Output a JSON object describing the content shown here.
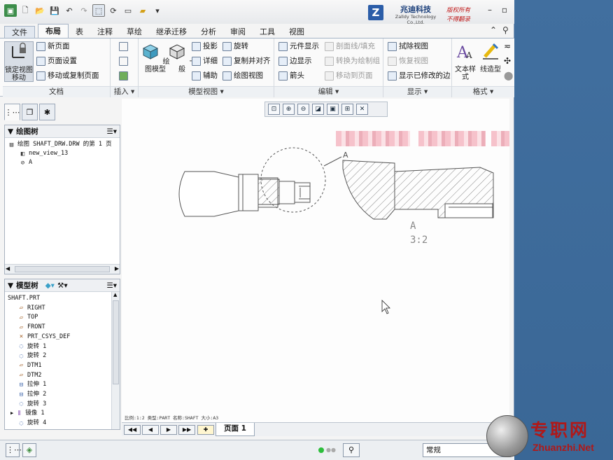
{
  "titlebar": {
    "logo_mark": "Z",
    "logo_cn": "兆迪科技",
    "logo_en": "Zalldy Technology Co.,Ltd.",
    "rights_1": "版权所有",
    "rights_2": "不得翻录"
  },
  "menu": {
    "file": "文件",
    "tabs": [
      "布局",
      "表",
      "注释",
      "草绘",
      "继承迁移",
      "分析",
      "审阅",
      "工具",
      "视图"
    ],
    "active_tab": "布局"
  },
  "ribbon": {
    "doc": {
      "lock_label": "锁定视图移动",
      "new_page": "新页面",
      "page_setup": "页面设置",
      "move_copy_page": "移动或复制页面",
      "group": "文档"
    },
    "insert": {
      "group": "插入"
    },
    "model_views": {
      "drawing_model": "绘图模型",
      "general": "一般",
      "projection": "投影",
      "detailed": "详细",
      "auxiliary": "辅助",
      "revolve": "旋转",
      "copy_align": "复制并对齐",
      "drawing_view": "绘图视图",
      "group": "模型视图"
    },
    "edit": {
      "element_display": "元件显示",
      "edge_display": "边显示",
      "arrow": "箭头",
      "section_line_fill": "剖面线/填充",
      "convert_to_draft": "转换为绘制组",
      "move_to_page": "移动到页面",
      "group": "编辑"
    },
    "display": {
      "erase_view": "拭除视图",
      "restore_view": "恢复视图",
      "show_modified_edges": "显示已修改的边",
      "group": "显示"
    },
    "format": {
      "text_style": "文本样式",
      "line_type": "线造型",
      "group": "格式"
    }
  },
  "drawing_tree": {
    "title": "绘图树",
    "items": [
      "绘图 SHAFT_DRW.DRW 的第 1 页",
      "new_view_13",
      "A"
    ]
  },
  "model_tree": {
    "title": "模型树",
    "items": [
      "SHAFT.PRT",
      "RIGHT",
      "TOP",
      "FRONT",
      "PRT_CSYS_DEF",
      "旋转 1",
      "旋转 2",
      "DTM1",
      "DTM2",
      "拉伸 1",
      "拉伸 2",
      "旋转 3",
      "镜像 1",
      "旋转 4"
    ],
    "icons": [
      "part",
      "plane",
      "plane",
      "plane",
      "csys",
      "revolve",
      "revolve",
      "plane",
      "plane",
      "extrude",
      "extrude",
      "revolve",
      "mirror",
      "revolve"
    ]
  },
  "drawing": {
    "callout": "A",
    "detail_label": "A",
    "detail_scale": "3:2"
  },
  "stamp": "比例:1:2    类型:PART   名称:SHAFT  大小:A3",
  "pagebar": {
    "page_label": "页面 1"
  },
  "status": {
    "filter": "常规"
  },
  "watermark": {
    "text_cn": "专职网",
    "text_url": "Zhuanzhi.Net"
  }
}
